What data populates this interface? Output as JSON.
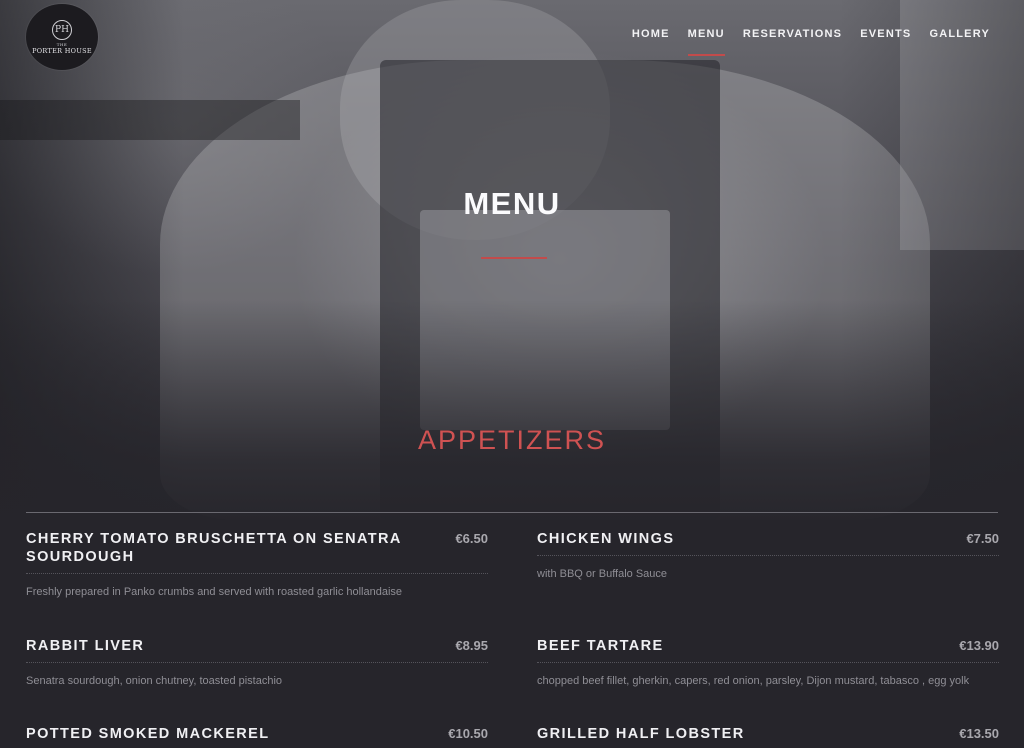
{
  "brand": {
    "monogram": "PH",
    "small_text": "THE",
    "name": "PORTER HOUSE"
  },
  "nav": {
    "items": [
      {
        "label": "HOME"
      },
      {
        "label": "MENU"
      },
      {
        "label": "RESERVATIONS"
      },
      {
        "label": "EVENTS"
      },
      {
        "label": "GALLERY"
      }
    ],
    "active": "MENU"
  },
  "hero": {
    "title": "MENU"
  },
  "section": {
    "title": "APPETIZERS"
  },
  "menu": {
    "left": [
      {
        "name": "CHERRY TOMATO BRUSCHETTA ON SENATRA SOURDOUGH",
        "price": "€6.50",
        "description": "Freshly prepared in Panko crumbs and served with roasted garlic hollandaise"
      },
      {
        "name": "RABBIT LIVER",
        "price": "€8.95",
        "description": "Senatra sourdough, onion chutney, toasted pistachio"
      },
      {
        "name": "POTTED SMOKED MACKEREL",
        "price": "€10.50",
        "description": ""
      }
    ],
    "right": [
      {
        "name": "CHICKEN WINGS",
        "price": "€7.50",
        "description": "with BBQ or Buffalo Sauce"
      },
      {
        "name": "BEEF TARTARE",
        "price": "€13.90",
        "description": "chopped beef fillet, gherkin, capers, red onion, parsley, Dijon mustard, tabasco , egg yolk"
      },
      {
        "name": "GRILLED HALF LOBSTER",
        "price": "€13.50",
        "description": ""
      }
    ]
  },
  "colors": {
    "accent": "#c24b4b",
    "section_title": "#cf5252",
    "background": "#26252b"
  }
}
